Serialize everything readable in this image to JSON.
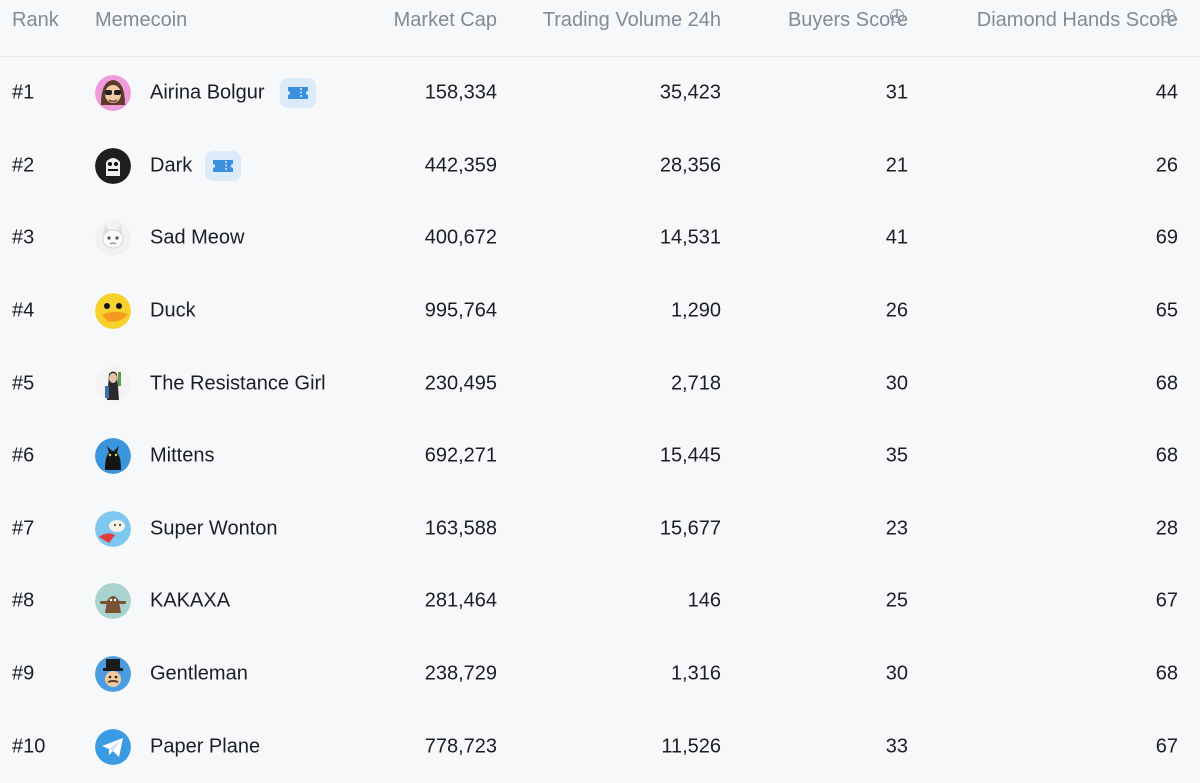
{
  "columns": {
    "rank": "Rank",
    "memecoin": "Memecoin",
    "market_cap": "Market Cap",
    "volume": "Trading Volume 24h",
    "buyers": "Buyers Score",
    "diamond": "Diamond Hands Score"
  },
  "info_glyph": "i",
  "rows": [
    {
      "rank": "#1",
      "name": "Airina Bolgur",
      "market_cap": "158,334",
      "volume": "35,423",
      "buyers": "31",
      "diamond": "44",
      "avatar": "girl-with-glasses-avatar",
      "ticket": true
    },
    {
      "rank": "#2",
      "name": "Dark",
      "market_cap": "442,359",
      "volume": "28,356",
      "buyers": "21",
      "diamond": "26",
      "avatar": "dark-character-avatar",
      "ticket": true
    },
    {
      "rank": "#3",
      "name": "Sad Meow",
      "market_cap": "400,672",
      "volume": "14,531",
      "buyers": "41",
      "diamond": "69",
      "avatar": "white-cat-avatar",
      "ticket": false
    },
    {
      "rank": "#4",
      "name": "Duck",
      "market_cap": "995,764",
      "volume": "1,290",
      "buyers": "26",
      "diamond": "65",
      "avatar": "duck-avatar",
      "ticket": false
    },
    {
      "rank": "#5",
      "name": "The Resistance Girl",
      "market_cap": "230,495",
      "volume": "2,718",
      "buyers": "30",
      "diamond": "68",
      "avatar": "resistance-girl-avatar",
      "ticket": false
    },
    {
      "rank": "#6",
      "name": "Mittens",
      "market_cap": "692,271",
      "volume": "15,445",
      "buyers": "35",
      "diamond": "68",
      "avatar": "black-cat-avatar",
      "ticket": false
    },
    {
      "rank": "#7",
      "name": "Super Wonton",
      "market_cap": "163,588",
      "volume": "15,677",
      "buyers": "23",
      "diamond": "28",
      "avatar": "super-wonton-avatar",
      "ticket": false
    },
    {
      "rank": "#8",
      "name": "KAKAXA",
      "market_cap": "281,464",
      "volume": "146",
      "buyers": "25",
      "diamond": "67",
      "avatar": "kakaxa-avatar",
      "ticket": false
    },
    {
      "rank": "#9",
      "name": "Gentleman",
      "market_cap": "238,729",
      "volume": "1,316",
      "buyers": "30",
      "diamond": "68",
      "avatar": "gentleman-avatar",
      "ticket": false
    },
    {
      "rank": "#10",
      "name": "Paper Plane",
      "market_cap": "778,723",
      "volume": "11,526",
      "buyers": "33",
      "diamond": "67",
      "avatar": "paper-plane-avatar",
      "ticket": false
    }
  ],
  "colors": {
    "background": "#f7f8fa",
    "header_text": "#7f8b96",
    "body_text": "#1b1f24",
    "ticket_bg": "#dcebfa",
    "ticket_icon": "#3d8fe0"
  }
}
